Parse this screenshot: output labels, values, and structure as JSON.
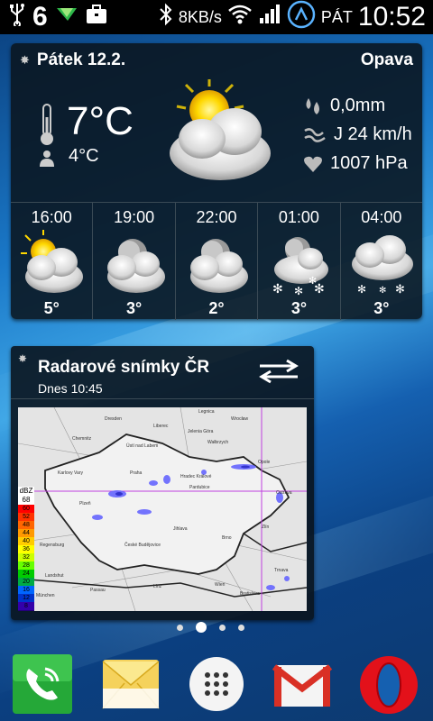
{
  "statusbar": {
    "notification_count": "6",
    "net_speed": "8KB/s",
    "day": "PÁT",
    "time": "10:52"
  },
  "weather_widget": {
    "date": "Pátek 12.2.",
    "city": "Opava",
    "temperature": "7°C",
    "feels_like": "4°C",
    "precipitation": "0,0mm",
    "wind": "J 24 km/h",
    "pressure": "1007 hPa",
    "current_icon": "partly-sunny-icon",
    "forecast": [
      {
        "time": "16:00",
        "temp": "5°",
        "icon": "partly-sunny-icon"
      },
      {
        "time": "19:00",
        "temp": "3°",
        "icon": "moon-cloud-icon"
      },
      {
        "time": "22:00",
        "temp": "2°",
        "icon": "moon-cloud-icon"
      },
      {
        "time": "01:00",
        "temp": "3°",
        "icon": "moon-snow-icon"
      },
      {
        "time": "04:00",
        "temp": "3°",
        "icon": "cloud-snow-icon"
      }
    ]
  },
  "radar_widget": {
    "title": "Radarové snímky ČR",
    "subtitle": "Dnes 10:45",
    "legend_unit": "dBZ",
    "legend_top": "68",
    "legend": [
      {
        "value": "60",
        "color": "#ff0000"
      },
      {
        "value": "52",
        "color": "#ff3300"
      },
      {
        "value": "48",
        "color": "#ff6600"
      },
      {
        "value": "44",
        "color": "#ff9900"
      },
      {
        "value": "40",
        "color": "#ffcc00"
      },
      {
        "value": "36",
        "color": "#ffff00"
      },
      {
        "value": "32",
        "color": "#ccff00"
      },
      {
        "value": "28",
        "color": "#66ff00"
      },
      {
        "value": "24",
        "color": "#00cc00"
      },
      {
        "value": "20",
        "color": "#00aa44"
      },
      {
        "value": "16",
        "color": "#0066ff"
      },
      {
        "value": "12",
        "color": "#0033cc"
      },
      {
        "value": "8",
        "color": "#3300aa"
      },
      {
        "value": "4",
        "color": "#220077"
      }
    ],
    "cities": [
      "Dresden",
      "Liberec",
      "Legnica",
      "Wrocław",
      "Chemnitz",
      "Ústí nad Labem",
      "Jelenia Góra",
      "Wałbrzych",
      "Karlovy Vary",
      "Praha",
      "Hradec Králové",
      "Opole",
      "Plzeň",
      "Pardubice",
      "Ostrava",
      "Regensburg",
      "České Budějovice",
      "Jihlava",
      "Brno",
      "Zlín",
      "Linz",
      "Wien",
      "Bratislava",
      "Trnava",
      "Landshut",
      "München",
      "Passau"
    ]
  },
  "home": {
    "pager_pages": 4,
    "pager_active": 1
  },
  "dock": [
    {
      "name": "phone-app-icon"
    },
    {
      "name": "messaging-app-icon"
    },
    {
      "name": "app-drawer-icon"
    },
    {
      "name": "gmail-app-icon"
    },
    {
      "name": "opera-app-icon"
    }
  ]
}
